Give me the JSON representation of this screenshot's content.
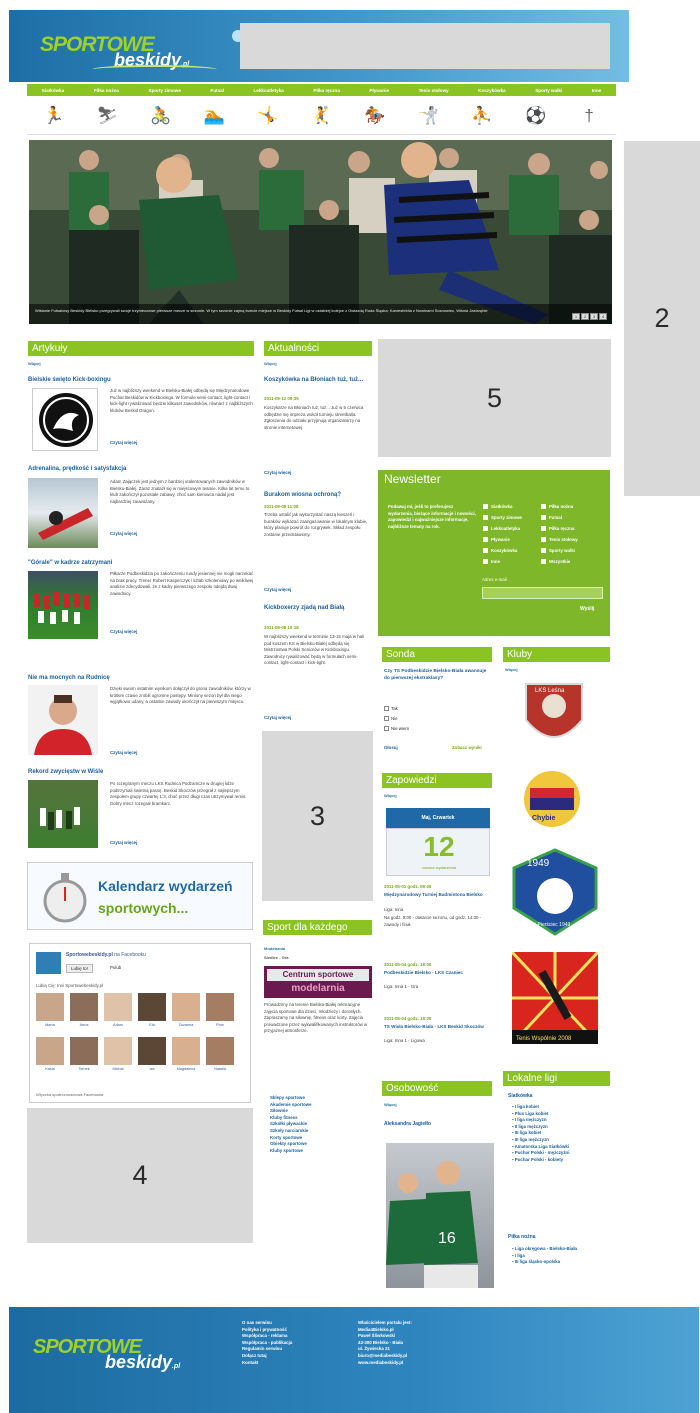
{
  "header": {
    "logo_top": "SPORTOWE",
    "logo_bottom": "beskidy",
    "logo_suffix": ".pl",
    "ad1": "1"
  },
  "nav": {
    "items": [
      "Siatkówka",
      "Piłka nożna",
      "Sporty zimowe",
      "Futsal",
      "Lekkoatletyka",
      "Piłka ręczna",
      "Pływanie",
      "Tenis stołowy",
      "Koszykówka",
      "Sporty walki",
      "Inne"
    ]
  },
  "sport_icons": [
    "runner-icon",
    "skier-icon",
    "cyclist-icon",
    "swimmer-icon",
    "athlete-icon",
    "jumper-icon",
    "rider-icon",
    "boxer-icon",
    "player-icon",
    "footballer-icon",
    "other-icon"
  ],
  "hero": {
    "caption": "Wiślanie Futsalowy Beskidy Bielsko przegrywali swoje trzymeczowe pierwsze mecze w sezonie. W tym sezonie zajmą trzecie miejsce w Beskidy Futsal Ligi w ostatniej kolejce z Gwiazdą Ruda Śląska; Kamesfeldia z Nowinami Sosnowiec, Wiśnia Jastrzębie",
    "pager": [
      "1",
      "2",
      "3",
      "4"
    ]
  },
  "ad2": "2",
  "ad3": "3",
  "ad4": "4",
  "ad5": "5",
  "articles": {
    "heading": "Artykuły",
    "more": "Więcej",
    "items": [
      {
        "title": "Bielskie święto Kick-boxingu",
        "body": "Już w najbliższy weekend w Bielsku-Białej odbędą się Międzynarodowe Puchar Beskidów w Kickboxingu. W formule semi-contact, light-contact i kick-light rywalizować będzie kilkuset zawodników, również z najbliższych klubów Beskid Dragon.",
        "read": "Czytaj więcej"
      },
      {
        "title": "Adrenalina, prędkość i satysfakcja",
        "body": "Adam Zajączek jest jednym z bardziej utalentowanych zawodników w Bielsku-Białej. Zaraz znalazł się w miejscowym teamie. Kilka lat temu to klub zakończył pozostałe zabawy, choć sam kierowca nadal jest najbardziej zauważany.",
        "read": "Czytaj więcej"
      },
      {
        "title": "\"Górale\" w kadrze zatrzymani",
        "body": "Piłkarze Podbeskidzia po zakończeniu rundy jesiennej nie mogli narzekać na brak pracy. Trener Robert Kasperczyk i sztab szkoleniowy po wnikliwej analizie zdecydowali, że z kadry pierwszego zespołu odejdą dwaj zawodnicy.",
        "read": "Czytaj więcej"
      },
      {
        "title": "Nie ma mocnych na Rudnicę",
        "body": "Dzięki swoim ostatnim wynikom dołączył do grona zawodników, którzy w krótkim czasie zrobili ogromne postępy. Miniony sezon był dla niego wyjątkowo udany, a ostatnie zawody ukończył na pierwszym miejscu.",
        "read": "Czytaj więcej"
      },
      {
        "title": "Rekord zwycięstw w Wiśle",
        "body": "Po rozegranym meczu LKS Rudnica Podzamcze w drugiej lidze podtrzymali świetną passę. Beskid Skoczów przegrał z najlepszym zespołem grupy czwartej 1:3, choć przez długi czas utrzymywał remis. Dobry mecz rozegrał bramkarz.",
        "read": "Czytaj więcej"
      }
    ]
  },
  "calendar": {
    "line1": "Kalendarz wydarzeń",
    "line2": "sportowych..."
  },
  "facebook": {
    "page_name": "Sportowebeskidy.pl",
    "sub": "na Facebooku",
    "like": "Lubię to!",
    "count": "Polub",
    "people": "Lubią Cię: Inni Sportowebeskidy.pl",
    "names": [
      "Marta",
      "Anna",
      "Adam",
      "Ela",
      "Zuzanna",
      "Piotr",
      "Kasia",
      "Tomek",
      "Michał",
      "Iza",
      "Magdalena",
      "Natalia"
    ],
    "plugin": "Wtyczka społecznościowa Facebooka"
  },
  "news": {
    "heading": "Aktualności",
    "more": "Więcej",
    "items": [
      {
        "title": "Koszykówka na Błoniach tuż, tuż...",
        "date": "2011-09-12 09:35",
        "body": "Koszykarze na Błoniach tuż, tuż... Już w 5 czerwca odbędzie się impreza wokół turnieju streetballa. Zgłoszenia do udziału przyjmują organizatorzy na stronie internetowej.",
        "read": "Czytaj więcej"
      },
      {
        "title": "Burakom wiosna ochroną?",
        "date": "2011-09-09 11:08",
        "body": "Trzeba ustalić jak wykorzystać naszą kieszeń i buraków wykazać zaangażowanie w lokalnym klubie, który planuje powrót do rozgrywek. Skład zespołu zostanie przedstawiony.",
        "read": "Czytaj więcej"
      },
      {
        "title": "Kickboxerzy zjadą nad Białą",
        "date": "2011-09-08 10:18",
        "body": "W najbliższy weekend w terminie 13-15 maja w hali pod koszem KS w Bielsku-Białej odbędą się Mistrzostwa Polski Seniorów w Kickboxingu. Zawodnicy rywalizować będą w formułach semi-contact, light-contact i kick-light.",
        "read": "Czytaj więcej"
      }
    ]
  },
  "sport_for_all": {
    "heading": "Sport dla każdego",
    "sub1": "Modelarnia",
    "sub2": "Siedlec - Gra",
    "banner1": "Centrum sportowe",
    "banner2": "modelarnia",
    "body": "Prowadzimy na terenie Bielska-Białej rekreacyjne zajęcia sportowe dla dzieci, młodzieży i dorosłych. Zapraszamy na siłownię, fitness oraz korty. Zajęcia prowadzone przez wykwalifikowanych instruktorów w przyjaznej atmosferze.",
    "links": [
      "Sklepy sportowe",
      "Akademie sportowe",
      "Siłownie",
      "Kluby fitness",
      "Szkółki pływackie",
      "Szkoły narciarskie",
      "Korty sportowe",
      "Obiekty sportowe",
      "Kluby sportowe"
    ]
  },
  "newsletter": {
    "heading": "Newsletter",
    "text": "Podawaj mi, jeśli to preferujesz wydarzenia, bieżące informacje i nowości, zapowiedzi i najważniejsze informacje, najbliższe tematy na rok.",
    "options_col1": [
      "Siatkówka",
      "Sporty zimowe",
      "Lekkoatletyka",
      "Pływanie",
      "Koszykówka",
      "Inne"
    ],
    "options_col2": [
      "Piłka nożna",
      "Futsal",
      "Piłka ręczna",
      "Tenis stołowy",
      "Sporty walki",
      "Wszystkie"
    ],
    "email_label": "Adres e-mail",
    "submit": "Wyślij"
  },
  "poll": {
    "heading": "Sonda",
    "question": "Czy TS Podbeskidzie Bielsko-Biała awansuje do pierwszej ekstraklasy?",
    "options": [
      "Tak",
      "Nie",
      "Nie wiem"
    ],
    "vote": "Głosuj",
    "results": "Zobacz wyniki"
  },
  "announcements": {
    "heading": "Zapowiedzi",
    "more": "Więcej",
    "day": "Maj, Czwartek",
    "date_num": "12",
    "events_count": "zobacz wydarzenia",
    "items": [
      {
        "when": "2011-05-01 godz. 09:00",
        "title": "Międzynarodowy Turniej Badmintona Bielsko",
        "loc": "Liga: Inna",
        "body": "Na godz. 9:00 - otwarcie sezonu, od godz. 14:30 - zawody i finał."
      },
      {
        "when": "2011-05-04 godz. 18:00",
        "title": "Podbeskidzie Bielsko - LKS Czaniec",
        "loc": "Liga: Inna 1 - Gra"
      },
      {
        "when": "2011-05-04 godz. 18:00",
        "title": "TS Wisła Bielsko-Biała - LKS Beskid Skoczów",
        "loc": "Liga: Inna 1 - Ligowa"
      }
    ]
  },
  "personality": {
    "heading": "Osobowość",
    "more": "Więcej",
    "name": "Aleksandra Jagiełło"
  },
  "clubs": {
    "heading": "Kluby",
    "more": "Więcej",
    "items": [
      "LKS Leśna",
      "Chybie",
      "Błękitni Pierściec 1949",
      "Tenis Wspólnie 2008"
    ]
  },
  "leagues": {
    "heading": "Lokalne ligi",
    "group1_title": "Siatkówka",
    "group1": [
      "I liga kobiet",
      "Plus Liga kobiet",
      "I liga mężczyzn",
      "II liga mężczyzn",
      "III liga kobiet",
      "III liga mężczyzn",
      "Amatorska Liga Siatkówki",
      "Puchar Polski - mężczyźni",
      "Puchar Polski - kobiety"
    ],
    "group2_title": "Piłka nożna",
    "group2": [
      "Liga okręgowa - Bielsko-Biała",
      "I liga",
      "III liga śląsko-opolska"
    ]
  },
  "footer": {
    "links": [
      "O nas serwisu",
      "Polityka i prywatność",
      "Współpraca - reklama",
      "Współpraca - publikacja",
      "Regulamin serwisu",
      "Dołącz tutaj",
      "Kontakt"
    ],
    "contact": [
      "Właścicielem portalu jest:",
      "Media4Bielsko.pl",
      "Paweł Śliwkowski",
      "43-300 Bielsko - Biała",
      "ul. Żywiecka 21",
      "biuro@mediabeskidy.pl",
      "www.mediabeskidy.pl"
    ]
  },
  "colors": {
    "green": "#8bc322",
    "blue": "#1d6ea4",
    "link": "#1a5f9b"
  }
}
